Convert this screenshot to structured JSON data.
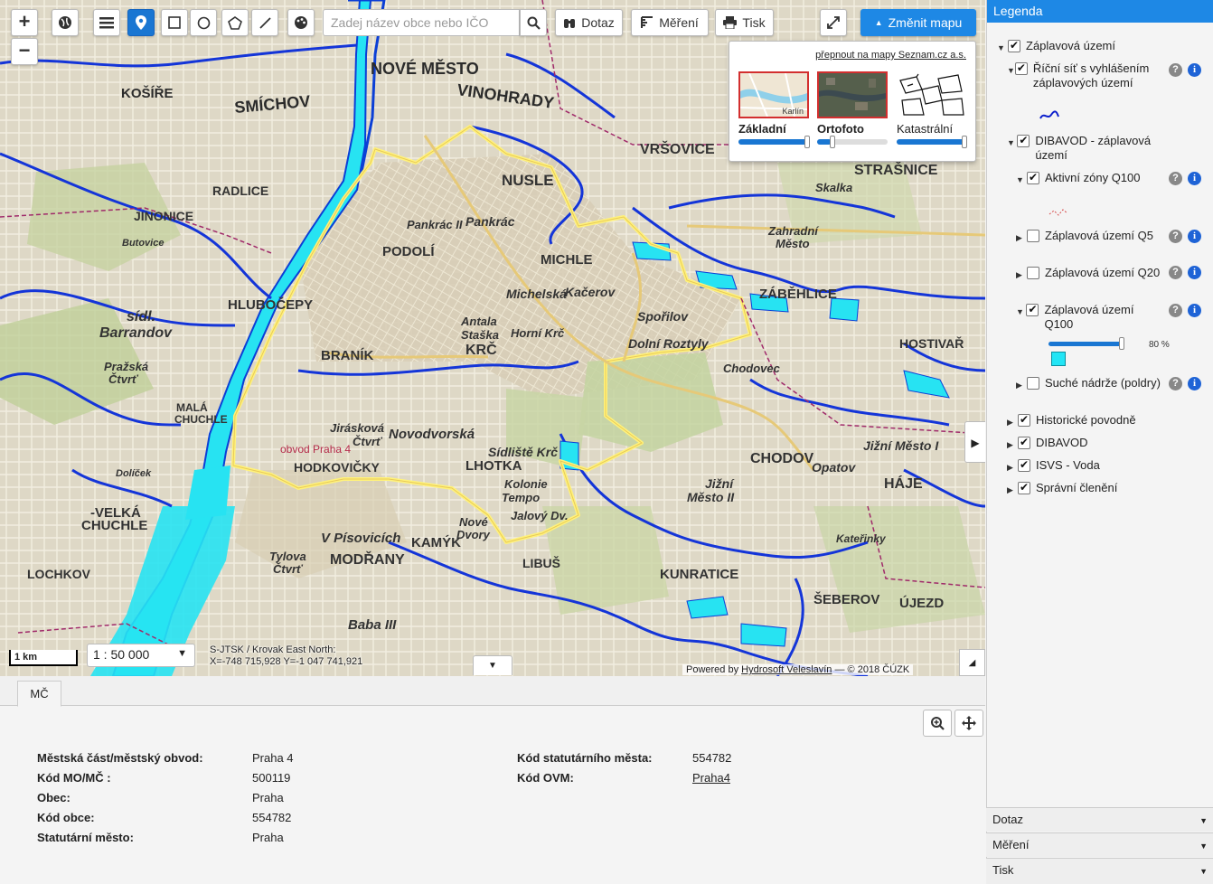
{
  "toolbar": {
    "search_placeholder": "Zadej název obce nebo IČO",
    "dotaz_label": "Dotaz",
    "mereni_label": "Měření",
    "tisk_label": "Tisk",
    "change_map_label": "Změnit mapu"
  },
  "basemaps": {
    "seznam_link": "přepnout na mapy Seznam.cz a.s.",
    "items": [
      {
        "name": "Základní",
        "thumb_label": "Karlín",
        "opacity": 1.0,
        "selected": true
      },
      {
        "name": "Ortofoto",
        "opacity": 0.0,
        "selected": false
      },
      {
        "name": "Katastrální",
        "opacity": 1.0,
        "selected": false
      }
    ]
  },
  "map": {
    "scale_bar": "1 km",
    "scale_value": "1 : 50 000",
    "coord_system": "S-JTSK / Krovak East North:",
    "coords": "X=-748 715,928 Y=-1 047 741,921",
    "powered_prefix": "Powered by",
    "powered_company": "Hydrosoft Veleslavín",
    "powered_suffix": "— © 2018 ČÚZK",
    "places": [
      "NOVÉ MĚSTO",
      "VINOHRADY",
      "SMÍCHOV",
      "KOŠÍŘE",
      "NUSLE",
      "VRŠOVICE",
      "STRAŠNICE",
      "Pankrác",
      "Pankrác II",
      "PODOLÍ",
      "MICHLE",
      "Michelská",
      "Kačerov",
      "Spořilov",
      "Dolní Roztyly",
      "BRANÍK",
      "KRČ",
      "Antala Staška",
      "Horní Krč",
      "Novodvorská",
      "Jirásková Čtvrť",
      "HODKOVIČKY",
      "Sídliště Krč",
      "LHOTKA",
      "Kolonie Tempo",
      "Jalový Dv.",
      "CHODOV",
      "Opatov",
      "Jižní Město I",
      "Jižní Město II",
      "HÁJE",
      "KAMÝK",
      "MODŘANY",
      "V Písovicích",
      "LIBUŠ",
      "KUNRATICE",
      "ŠEBEROV",
      "ÚJEZD",
      "HOSTIVAŘ",
      "Chodovec",
      "RADLICE",
      "JINONICE",
      "HLUBOČEPY",
      "sídl. Barrandov",
      "Pražská Čtvrť",
      "MALÁ CHUCHLE",
      "-VELKÁ CHUCHLE",
      "LOCHKOV",
      "Tylova Čtvrť",
      "Baba III",
      "Záběhlice",
      "Zahradní Město",
      "Skalka",
      "Butovice",
      "Dolíček",
      "Nové Dvory",
      "Obvod Praha 4",
      "Kateřinky"
    ]
  },
  "legend": {
    "title": "Legenda",
    "items": [
      {
        "label": "Záplavová území",
        "checked": true,
        "expanded": true
      },
      {
        "label": "Říční síť s vyhlášením záplavových území",
        "checked": true,
        "expanded": true
      },
      {
        "label": "DIBAVOD - záplavová území",
        "checked": true,
        "expanded": true
      },
      {
        "label": "Aktivní zóny Q100",
        "checked": true,
        "expanded": true
      },
      {
        "label": "Záplavová území Q5",
        "checked": false,
        "expanded": false
      },
      {
        "label": "Záplavová území Q20",
        "checked": false,
        "expanded": false
      },
      {
        "label": "Záplavová území Q100",
        "checked": true,
        "expanded": true
      },
      {
        "label": "Suché nádrže (poldry)",
        "checked": false,
        "expanded": false
      },
      {
        "label": "Historické povodně",
        "checked": true,
        "expanded": false
      },
      {
        "label": "DIBAVOD",
        "checked": true,
        "expanded": false
      },
      {
        "label": "ISVS - Voda",
        "checked": true,
        "expanded": false
      },
      {
        "label": "Správní členění",
        "checked": true,
        "expanded": false
      }
    ],
    "q100_opacity": "80 %",
    "accordion": [
      "Dotaz",
      "Měření",
      "Tisk"
    ]
  },
  "bottom": {
    "tab_label": "MČ",
    "left_attrs": [
      {
        "key": "Městská část/městský obvod:",
        "value": "Praha 4"
      },
      {
        "key": "Kód MO/MČ :",
        "value": "500119"
      },
      {
        "key": "Obec:",
        "value": "Praha"
      },
      {
        "key": "Kód obce:",
        "value": "554782"
      },
      {
        "key": "Statutární město:",
        "value": "Praha"
      }
    ],
    "right_attrs": [
      {
        "key": "Kód statutárního města:",
        "value": "554782"
      },
      {
        "key": "Kód OVM:",
        "value": "Praha4"
      }
    ]
  }
}
